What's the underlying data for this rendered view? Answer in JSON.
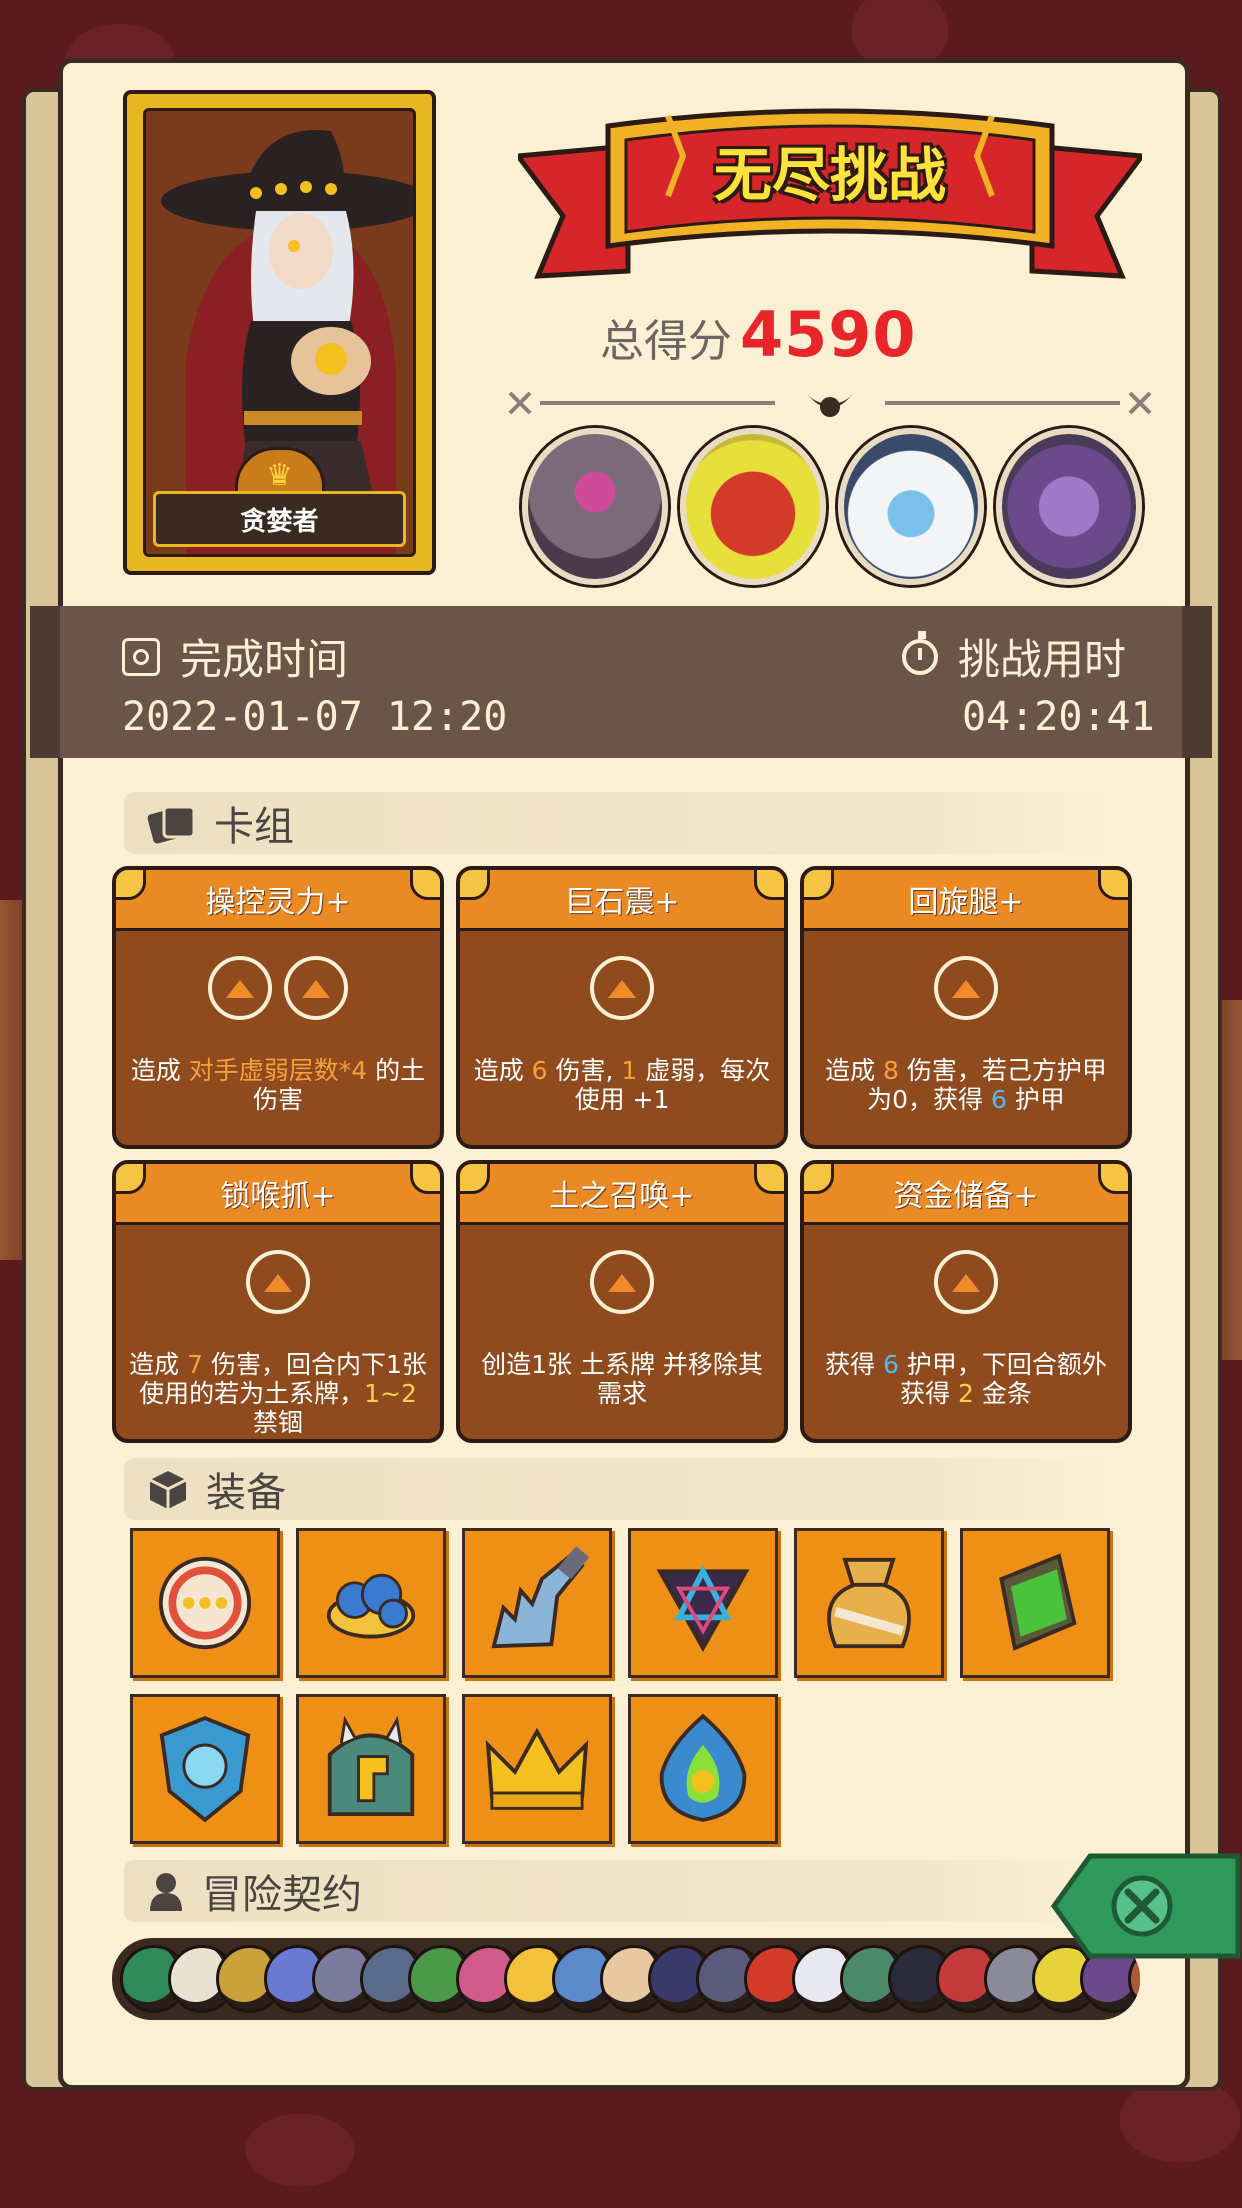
{
  "hero": {
    "name": "贪婪者"
  },
  "banner": {
    "title": "无尽挑战"
  },
  "score": {
    "label": "总得分",
    "value": "4590"
  },
  "bosses": [
    {
      "icon": "stone-golem-boss-icon",
      "color": "#8a6a7a"
    },
    {
      "icon": "red-demon-boss-icon",
      "color": "#d23a2a"
    },
    {
      "icon": "yeti-boss-icon",
      "color": "#eef4f6"
    },
    {
      "icon": "purple-dragon-boss-icon",
      "color": "#7a4a9a"
    }
  ],
  "time": {
    "finish_label": "完成时间",
    "finish_value": "2022-01-07 12:20",
    "duration_label": "挑战用时",
    "duration_value": "04:20:41"
  },
  "deck": {
    "label": "卡组",
    "cards": [
      {
        "title": "操控灵力+",
        "cost_icons": 2,
        "desc": [
          [
            "造成 ",
            ""
          ],
          [
            "对手虚弱层数*4",
            "hl"
          ],
          [
            " 的土伤害",
            ""
          ]
        ]
      },
      {
        "title": "巨石震+",
        "cost_icons": 1,
        "desc": [
          [
            "造成 ",
            ""
          ],
          [
            "6",
            "hl"
          ],
          [
            " 伤害, ",
            ""
          ],
          [
            "1",
            "hl"
          ],
          [
            " 虚弱，每次使用 ",
            ""
          ],
          [
            "+1",
            ""
          ]
        ]
      },
      {
        "title": "回旋腿+",
        "cost_icons": 1,
        "desc": [
          [
            "造成 ",
            ""
          ],
          [
            "8",
            "hl"
          ],
          [
            " 伤害，若己方护甲为0，获得 ",
            ""
          ],
          [
            "6",
            "blue"
          ],
          [
            " 护甲",
            ""
          ]
        ]
      },
      {
        "title": "锁喉抓+",
        "cost_icons": 1,
        "desc": [
          [
            "造成 ",
            ""
          ],
          [
            "7",
            "hl"
          ],
          [
            " 伤害，回合内下1张使用的若为",
            ""
          ],
          [
            "土系牌，",
            ""
          ],
          [
            "1~2",
            "gold"
          ],
          [
            " 禁锢",
            ""
          ]
        ]
      },
      {
        "title": "土之召唤+",
        "cost_icons": 1,
        "desc": [
          [
            "创造1张 ",
            ""
          ],
          [
            "土系牌 并移除其需求",
            ""
          ]
        ]
      },
      {
        "title": "资金储备+",
        "cost_icons": 1,
        "desc": [
          [
            "获得 ",
            ""
          ],
          [
            "6",
            "blue"
          ],
          [
            " 护甲，下回合额外获得 ",
            ""
          ],
          [
            "2",
            "gold"
          ],
          [
            " 金条",
            ""
          ]
        ]
      }
    ]
  },
  "equipment": {
    "label": "装备",
    "items": [
      "ring-shield-icon",
      "blue-mushroom-icon",
      "serrated-blade-icon",
      "hexagram-emblem-icon",
      "money-bag-icon",
      "green-scroll-icon",
      "jack-o-lantern-shield-icon",
      "spiked-helmet-icon",
      "golden-crown-icon",
      "blue-flame-crystal-icon"
    ]
  },
  "contract": {
    "label": "冒险契约",
    "icons": [
      "#2f8a5a",
      "#e8e2d0",
      "#caa23a",
      "#6a7ad0",
      "#7a7a9a",
      "#5a6a8a",
      "#4a9a4a",
      "#d05a8a",
      "#f2c23a",
      "#5a8aca",
      "#e8c8a0",
      "#3a3a6a",
      "#5a5a7a",
      "#d23a2a",
      "#e8e8f0",
      "#4a8a6a",
      "#2a2a3a",
      "#c23a3a",
      "#8a8a9a",
      "#e8d23a",
      "#6a4a8a",
      "#aa5a3a",
      "#3a2a2a",
      "#7a3ad0",
      "#b02a7a"
    ]
  },
  "colors": {
    "board": "#fbf0d4",
    "accent": "#e98a25",
    "score": "#e8262a",
    "background": "#5a1a1e"
  }
}
